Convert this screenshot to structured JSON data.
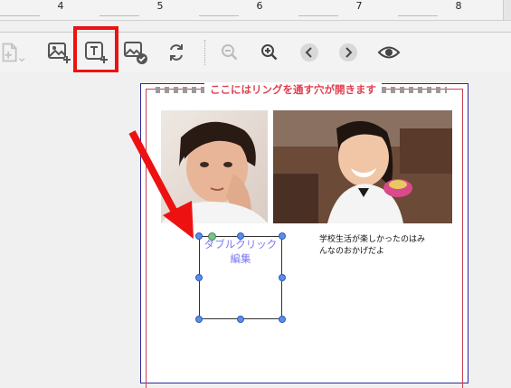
{
  "ruler": {
    "numbers": [
      "4",
      "5",
      "6",
      "7",
      "8"
    ]
  },
  "toolbar": {
    "buttons": [
      {
        "name": "add-page-icon",
        "enabled": false
      },
      {
        "name": "add-image-icon",
        "enabled": true
      },
      {
        "name": "add-text-icon",
        "enabled": true,
        "highlighted": true
      },
      {
        "name": "edit-image-icon",
        "enabled": true
      },
      {
        "name": "swap-icon",
        "enabled": true
      },
      {
        "name": "zoom-out-icon",
        "enabled": false
      },
      {
        "name": "zoom-in-icon",
        "enabled": true
      },
      {
        "name": "previous-page-icon",
        "enabled": true
      },
      {
        "name": "next-page-icon",
        "enabled": true
      },
      {
        "name": "preview-eye-icon",
        "enabled": true
      }
    ],
    "highlight_color": "#ee1111"
  },
  "page": {
    "ring_text": "ここにはリングを通す穴が開きます",
    "ring_text_color": "#e04050",
    "caption": "学校生活が楽しかったのはみんなのおかげだよ",
    "textbox_label": "ダブルクリック編集",
    "textbox_label_color": "#7a7af0"
  },
  "annotation": {
    "arrow_color": "#ee1111"
  }
}
